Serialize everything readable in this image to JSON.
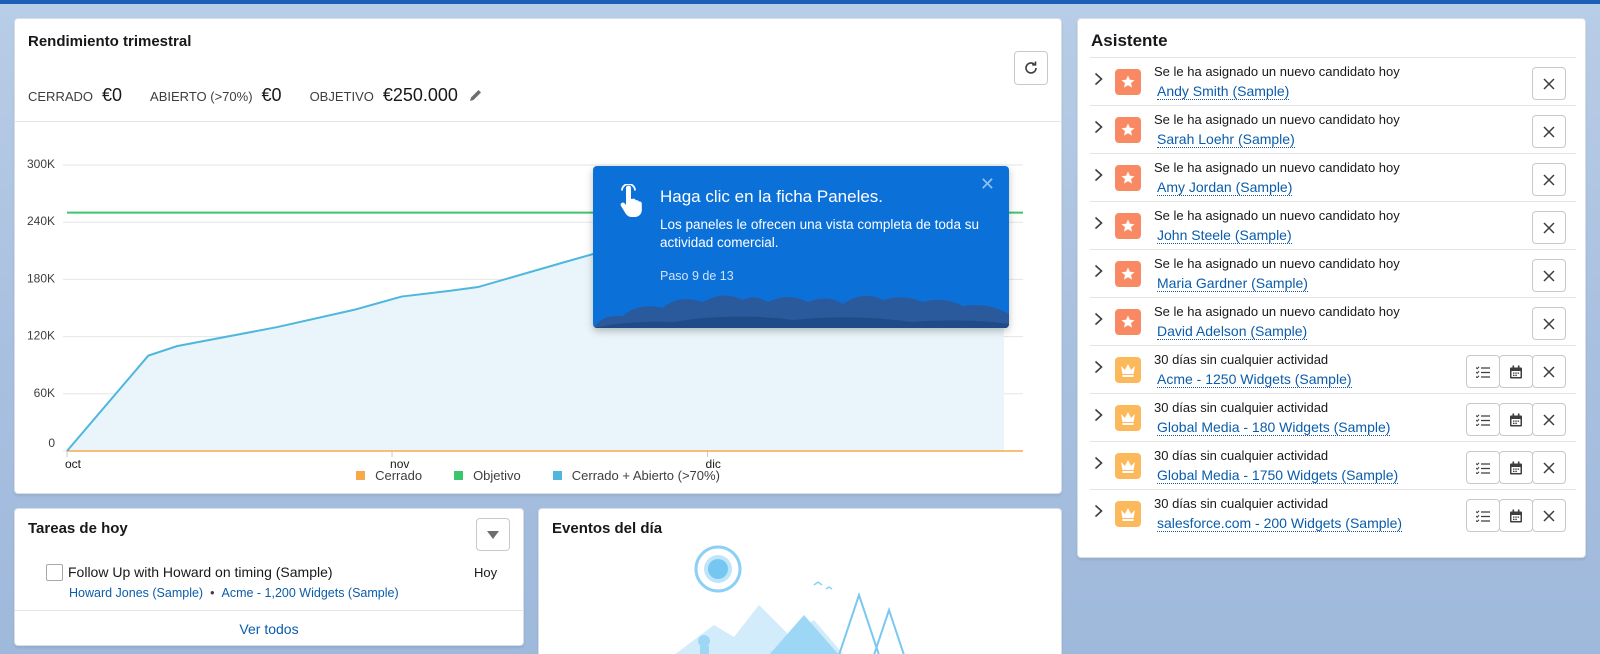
{
  "performance": {
    "title": "Rendimiento trimestral",
    "metrics": [
      {
        "label": "CERRADO",
        "value": "€0"
      },
      {
        "label": "ABIERTO (>70%)",
        "value": "€0"
      },
      {
        "label": "OBJETIVO",
        "value": "€250.000"
      }
    ]
  },
  "chart_data": {
    "type": "line",
    "x": [
      "oct",
      "nov",
      "dic"
    ],
    "yticks": [
      "300K",
      "240K",
      "180K",
      "120K",
      "60K",
      "0"
    ],
    "ylim": [
      0,
      300000
    ],
    "series": [
      {
        "name": "Cerrado",
        "color": "#f7a94a",
        "values": [
          [
            0,
            0
          ],
          [
            100,
            0
          ]
        ]
      },
      {
        "name": "Objetivo",
        "color": "#3ec46d",
        "values": [
          [
            0,
            250000
          ],
          [
            100,
            250000
          ]
        ]
      },
      {
        "name": "Cerrado + Abierto (>70%)",
        "color": "#4fb7dd",
        "values": [
          [
            0,
            0
          ],
          [
            8.5,
            100000
          ],
          [
            11.5,
            110000
          ],
          [
            22,
            130000
          ],
          [
            30,
            148000
          ],
          [
            35,
            162000
          ],
          [
            40,
            168000
          ],
          [
            43,
            172000
          ],
          [
            52,
            198000
          ],
          [
            58,
            215000
          ],
          [
            94.5,
            256000
          ],
          [
            95.5,
            258000
          ],
          [
            98,
            258000
          ]
        ]
      }
    ],
    "legend": "bottom",
    "grid": true
  },
  "walkthrough": {
    "title": "Haga clic en la ficha Paneles.",
    "body": "Los paneles le ofrecen una vista completa de toda su actividad comercial.",
    "step": "Paso 9 de 13"
  },
  "assistant": {
    "title": "Asistente",
    "items": [
      {
        "type": "lead",
        "message": "Se le ha asignado un nuevo candidato hoy",
        "link": "Andy Smith (Sample)"
      },
      {
        "type": "lead",
        "message": "Se le ha asignado un nuevo candidato hoy",
        "link": "Sarah Loehr (Sample)"
      },
      {
        "type": "lead",
        "message": "Se le ha asignado un nuevo candidato hoy",
        "link": "Amy Jordan (Sample)"
      },
      {
        "type": "lead",
        "message": "Se le ha asignado un nuevo candidato hoy",
        "link": "John Steele (Sample)"
      },
      {
        "type": "lead",
        "message": "Se le ha asignado un nuevo candidato hoy",
        "link": "Maria Gardner (Sample)"
      },
      {
        "type": "lead",
        "message": "Se le ha asignado un nuevo candidato hoy",
        "link": "David Adelson (Sample)"
      },
      {
        "type": "opportunity",
        "message": "30 días sin cualquier actividad",
        "link": "Acme - 1250 Widgets (Sample)"
      },
      {
        "type": "opportunity",
        "message": "30 días sin cualquier actividad",
        "link": "Global Media - 180 Widgets (Sample)"
      },
      {
        "type": "opportunity",
        "message": "30 días sin cualquier actividad",
        "link": "Global Media - 1750 Widgets (Sample)"
      },
      {
        "type": "opportunity",
        "message": "30 días sin cualquier actividad",
        "link": "salesforce.com - 200 Widgets (Sample)"
      }
    ]
  },
  "tasks": {
    "title": "Tareas de hoy",
    "items": [
      {
        "name": "Follow Up with Howard on timing (Sample)",
        "due": "Hoy",
        "contact": "Howard Jones (Sample)",
        "related": "Acme - 1,200 Widgets (Sample)"
      }
    ],
    "view_all": "Ver todos"
  },
  "events": {
    "title": "Eventos del día"
  },
  "colors": {
    "accent": "#0b71d9",
    "lead_icon": "#f88962",
    "opportunity_icon": "#fcb95b",
    "link": "#0b5cab"
  }
}
